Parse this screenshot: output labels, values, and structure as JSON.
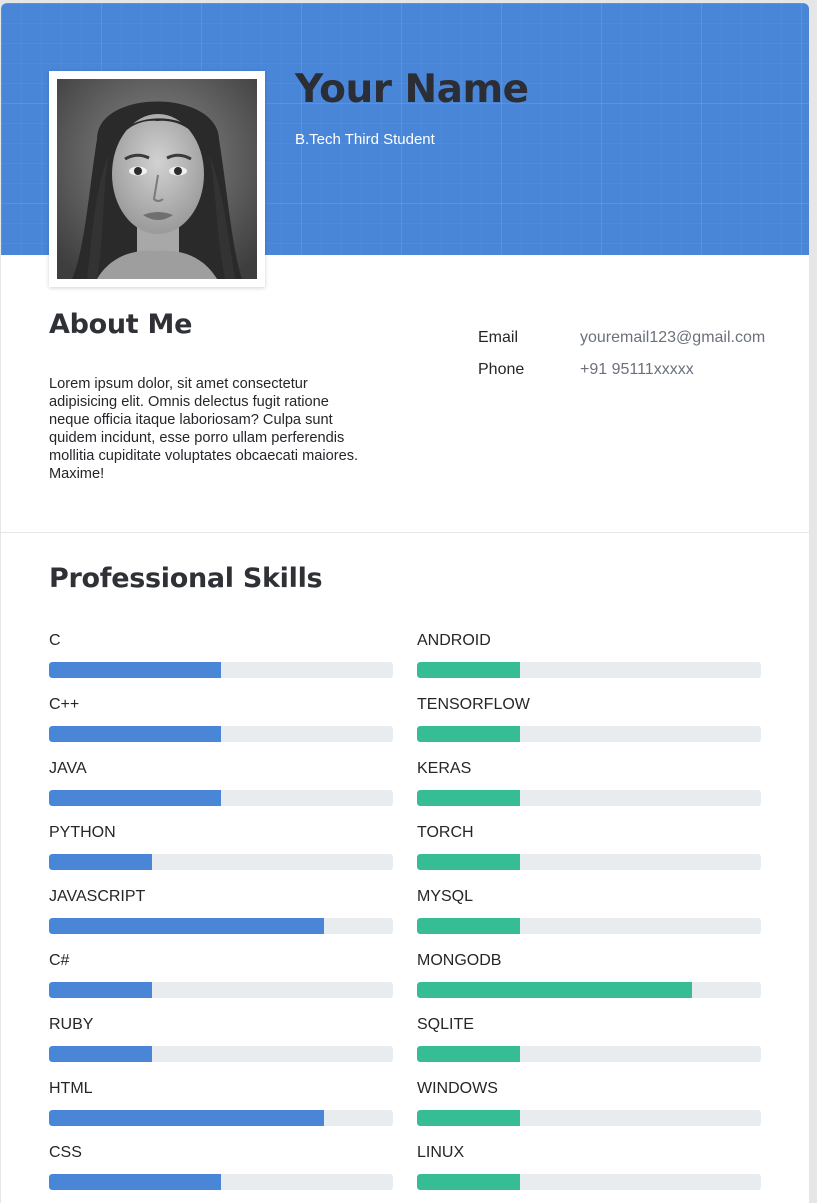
{
  "header": {
    "name": "Your Name",
    "subtitle": "B.Tech Third Student"
  },
  "about": {
    "title": "About Me",
    "text": "Lorem ipsum dolor, sit amet consectetur adipisicing elit. Omnis delectus fugit ratione neque officia itaque laboriosam? Culpa sunt quidem incidunt, esse porro ullam perferendis mollitia cupiditate voluptates obcaecati maiores. Maxime!"
  },
  "contact": [
    {
      "label": "Email",
      "value": "youremail123@gmail.com"
    },
    {
      "label": "Phone",
      "value": "+91 95111xxxxx"
    }
  ],
  "skills": {
    "title": "Professional Skills",
    "left_color": "#4a86d8",
    "right_color": "#37bd96",
    "track_color": "#e9ecef",
    "left": [
      {
        "name": "C",
        "level": 50
      },
      {
        "name": "C++",
        "level": 50
      },
      {
        "name": "JAVA",
        "level": 50
      },
      {
        "name": "PYTHON",
        "level": 30
      },
      {
        "name": "JAVASCRIPT",
        "level": 80
      },
      {
        "name": "C#",
        "level": 30
      },
      {
        "name": "RUBY",
        "level": 30
      },
      {
        "name": "HTML",
        "level": 80
      },
      {
        "name": "CSS",
        "level": 50
      }
    ],
    "right": [
      {
        "name": "ANDROID",
        "level": 30
      },
      {
        "name": "TENSORFLOW",
        "level": 30
      },
      {
        "name": "KERAS",
        "level": 30
      },
      {
        "name": "TORCH",
        "level": 30
      },
      {
        "name": "MYSQL",
        "level": 30
      },
      {
        "name": "MONGODB",
        "level": 80
      },
      {
        "name": "SQLITE",
        "level": 30
      },
      {
        "name": "WINDOWS",
        "level": 30
      },
      {
        "name": "LINUX",
        "level": 30
      }
    ]
  },
  "icons": {
    "profile_photo": "profile-photo"
  }
}
